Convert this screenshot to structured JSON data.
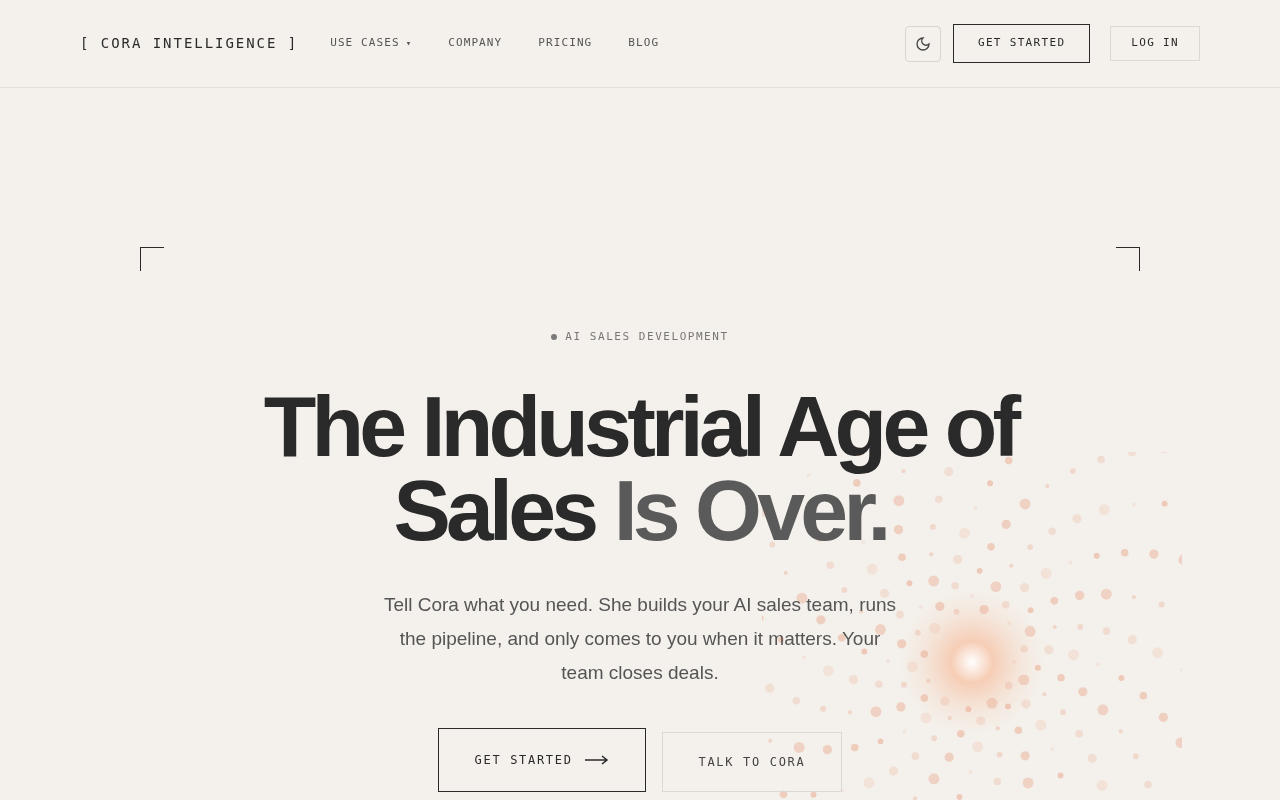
{
  "nav": {
    "logo": "[ CORA INTELLIGENCE ]",
    "links": [
      {
        "label": "USE CASES",
        "caret": "▾"
      },
      {
        "label": "COMPANY"
      },
      {
        "label": "PRICING"
      },
      {
        "label": "BLOG"
      }
    ],
    "get_started": "GET STARTED",
    "log_in": "LOG IN"
  },
  "hero": {
    "eyebrow": "AI SALES DEVELOPMENT",
    "headline": [
      [
        {
          "text": "The Industrial Age of",
          "color": "#2a2a2a"
        }
      ],
      [
        {
          "text": "Sales ",
          "color": "#2a2a2a"
        },
        {
          "text": "Is Over.",
          "color": "#5a5a5a"
        }
      ]
    ],
    "body": "Tell Cora what you need. She builds your AI sales team, runs the pipeline, and only comes to you when it matters. Your team closes deals.",
    "buttons": [
      {
        "label": "GET STARTED",
        "kind": "primary"
      },
      {
        "label": "TALK TO CORA",
        "kind": "secondary"
      }
    ]
  }
}
